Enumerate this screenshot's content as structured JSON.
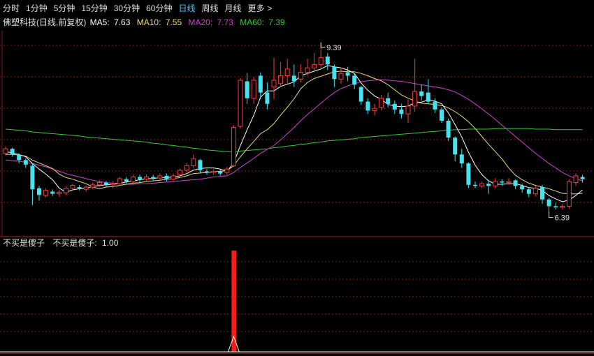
{
  "toolbar": {
    "tabs": [
      {
        "label": "分时",
        "active": false
      },
      {
        "label": "1分钟",
        "active": false
      },
      {
        "label": "5分钟",
        "active": false
      },
      {
        "label": "15分钟",
        "active": false
      },
      {
        "label": "30分钟",
        "active": false
      },
      {
        "label": "60分钟",
        "active": false
      },
      {
        "label": "日线",
        "active": true
      },
      {
        "label": "周线",
        "active": false
      },
      {
        "label": "月线",
        "active": false
      }
    ],
    "more_label": "更多",
    "more_icon": "chevron-right-icon"
  },
  "colors": {
    "background": "#000000",
    "up": "#ff3b3b",
    "down": "#45e3f0",
    "ma5": "#ffffff",
    "ma10": "#e8e070",
    "ma20": "#d040d0",
    "ma60": "#33cc33",
    "grid": "#8a1a1a",
    "signal": "#ff1a1a"
  },
  "chart_data": [
    {
      "type": "candlestick",
      "title": "佛塑科技(日线,前复权)",
      "indicators": [
        {
          "name": "MA5",
          "label": "MA5:",
          "value": "7.63",
          "color": "#ffffff"
        },
        {
          "name": "MA10",
          "label": "MA10:",
          "value": "7.55",
          "color": "#e8e070"
        },
        {
          "name": "MA20",
          "label": "MA20:",
          "value": "7.73",
          "color": "#d040d0"
        },
        {
          "name": "MA60",
          "label": "MA60:",
          "value": "7.39",
          "color": "#33cc33"
        }
      ],
      "annotations": {
        "high": "9.39",
        "low": "6.39"
      },
      "ylim": [
        6.15,
        9.6
      ],
      "grid": true,
      "candles": [
        [
          7.42,
          7.5,
          7.54,
          7.38
        ],
        [
          7.5,
          7.4,
          7.52,
          7.36
        ],
        [
          7.4,
          7.3,
          7.42,
          7.24
        ],
        [
          7.3,
          7.22,
          7.33,
          7.16
        ],
        [
          7.2,
          6.78,
          7.25,
          6.5
        ],
        [
          6.8,
          6.68,
          6.84,
          6.58
        ],
        [
          6.67,
          6.76,
          6.8,
          6.64
        ],
        [
          6.74,
          6.7,
          6.78,
          6.66
        ],
        [
          6.7,
          6.73,
          6.77,
          6.65
        ],
        [
          6.72,
          6.8,
          6.84,
          6.68
        ],
        [
          6.8,
          6.85,
          6.88,
          6.76
        ],
        [
          6.82,
          6.8,
          6.86,
          6.76
        ],
        [
          6.78,
          6.82,
          6.85,
          6.74
        ],
        [
          6.82,
          6.86,
          6.9,
          6.78
        ],
        [
          6.86,
          6.9,
          6.94,
          6.82
        ],
        [
          6.9,
          6.86,
          6.93,
          6.82
        ],
        [
          6.86,
          6.88,
          6.92,
          6.8
        ],
        [
          6.88,
          6.97,
          7.0,
          6.84
        ],
        [
          6.96,
          6.92,
          7.0,
          6.88
        ],
        [
          6.92,
          7.0,
          7.04,
          6.88
        ],
        [
          7.0,
          6.96,
          7.04,
          6.9
        ],
        [
          6.96,
          7.0,
          7.05,
          6.92
        ],
        [
          7.0,
          6.98,
          7.04,
          6.94
        ],
        [
          6.98,
          7.02,
          7.06,
          6.94
        ],
        [
          7.02,
          6.96,
          7.06,
          6.92
        ],
        [
          6.96,
          7.02,
          7.06,
          6.92
        ],
        [
          7.04,
          7.12,
          7.15,
          7.0
        ],
        [
          7.12,
          7.2,
          7.25,
          7.08
        ],
        [
          7.2,
          7.32,
          7.4,
          7.16
        ],
        [
          7.3,
          7.12,
          7.32,
          7.06
        ],
        [
          7.1,
          7.08,
          7.14,
          7.04
        ],
        [
          7.08,
          7.1,
          7.14,
          7.04
        ],
        [
          7.1,
          7.06,
          7.14,
          7.02
        ],
        [
          7.08,
          7.14,
          7.18,
          7.04
        ],
        [
          7.2,
          7.88,
          7.92,
          7.18
        ],
        [
          7.9,
          8.72,
          8.76,
          7.86
        ],
        [
          8.7,
          8.4,
          8.85,
          8.3
        ],
        [
          8.4,
          8.72,
          8.78,
          8.3
        ],
        [
          8.8,
          8.5,
          8.86,
          8.38
        ],
        [
          8.5,
          8.3,
          8.68,
          8.2
        ],
        [
          8.6,
          8.72,
          9.12,
          8.38
        ],
        [
          8.66,
          8.8,
          9.04,
          8.6
        ],
        [
          8.8,
          8.92,
          9.1,
          8.64
        ],
        [
          8.8,
          8.7,
          9.0,
          8.6
        ],
        [
          8.74,
          8.86,
          9.0,
          8.68
        ],
        [
          8.86,
          8.94,
          9.1,
          8.8
        ],
        [
          8.94,
          9.0,
          9.2,
          8.86
        ],
        [
          9.0,
          9.12,
          9.39,
          8.94
        ],
        [
          9.14,
          9.0,
          9.2,
          8.9
        ],
        [
          8.96,
          8.74,
          9.0,
          8.6
        ],
        [
          8.74,
          8.84,
          8.94,
          8.66
        ],
        [
          8.86,
          8.8,
          8.96,
          8.7
        ],
        [
          8.8,
          8.64,
          8.84,
          8.56
        ],
        [
          8.6,
          8.34,
          8.62,
          8.28
        ],
        [
          8.34,
          8.18,
          8.4,
          8.12
        ],
        [
          8.18,
          8.22,
          8.3,
          8.1
        ],
        [
          8.24,
          8.4,
          8.46,
          8.18
        ],
        [
          8.4,
          8.3,
          8.5,
          8.24
        ],
        [
          8.3,
          8.2,
          8.36,
          8.12
        ],
        [
          8.2,
          8.12,
          8.3,
          8.04
        ],
        [
          8.12,
          8.26,
          8.38,
          7.96
        ],
        [
          8.26,
          8.52,
          9.1,
          8.16
        ],
        [
          8.52,
          8.44,
          8.64,
          8.36
        ],
        [
          8.5,
          8.34,
          8.74,
          8.3
        ],
        [
          8.34,
          8.2,
          8.4,
          8.14
        ],
        [
          8.2,
          8.0,
          8.24,
          7.96
        ],
        [
          8.0,
          7.7,
          8.04,
          7.64
        ],
        [
          7.7,
          7.4,
          7.72,
          7.28
        ],
        [
          7.4,
          7.24,
          7.5,
          7.16
        ],
        [
          7.24,
          6.86,
          7.26,
          6.8
        ],
        [
          6.86,
          6.84,
          6.92,
          6.8
        ],
        [
          6.84,
          6.88,
          6.92,
          6.8
        ],
        [
          6.88,
          6.84,
          6.94,
          6.7
        ],
        [
          6.84,
          6.92,
          6.98,
          6.8
        ],
        [
          6.92,
          6.9,
          6.96,
          6.84
        ],
        [
          6.9,
          6.92,
          6.98,
          6.86
        ],
        [
          6.94,
          6.84,
          6.96,
          6.78
        ],
        [
          6.84,
          6.78,
          6.88,
          6.72
        ],
        [
          6.78,
          6.7,
          6.82,
          6.64
        ],
        [
          6.7,
          6.8,
          6.84,
          6.66
        ],
        [
          6.82,
          6.6,
          6.86,
          6.52
        ],
        [
          6.6,
          6.48,
          6.62,
          6.39
        ],
        [
          6.48,
          6.46,
          6.54,
          6.42
        ],
        [
          6.46,
          6.48,
          6.52,
          6.42
        ],
        [
          6.48,
          6.92,
          6.96,
          6.44
        ],
        [
          6.9,
          7.02,
          7.06,
          6.84
        ],
        [
          7.0,
          6.96,
          7.04,
          6.9
        ]
      ],
      "ma5": [
        7.45,
        7.43,
        7.4,
        7.36,
        7.24,
        7.14,
        7.05,
        6.95,
        6.8,
        6.73,
        6.77,
        6.79,
        6.8,
        6.83,
        6.85,
        6.86,
        6.87,
        6.89,
        6.91,
        6.93,
        6.95,
        6.97,
        6.97,
        6.99,
        6.99,
        7.0,
        7.02,
        7.06,
        7.12,
        7.15,
        7.16,
        7.16,
        7.14,
        7.1,
        7.25,
        7.56,
        7.84,
        8.1,
        8.42,
        8.53,
        8.53,
        8.61,
        8.65,
        8.69,
        8.8,
        8.84,
        8.88,
        8.92,
        8.98,
        8.96,
        8.94,
        8.9,
        8.84,
        8.67,
        8.54,
        8.44,
        8.38,
        8.29,
        8.26,
        8.25,
        8.26,
        8.32,
        8.33,
        8.37,
        8.35,
        8.3,
        8.14,
        7.93,
        7.71,
        7.44,
        7.21,
        7.04,
        6.93,
        6.87,
        6.87,
        6.88,
        6.88,
        6.85,
        6.81,
        6.8,
        6.76,
        6.67,
        6.61,
        6.56,
        6.59,
        6.67,
        6.77
      ],
      "ma10": [
        7.4,
        7.4,
        7.39,
        7.37,
        7.3,
        7.25,
        7.2,
        7.15,
        7.05,
        6.99,
        6.96,
        6.92,
        6.88,
        6.82,
        6.79,
        6.82,
        6.83,
        6.85,
        6.87,
        6.89,
        6.9,
        6.92,
        6.93,
        6.94,
        6.96,
        6.97,
        6.99,
        7.02,
        7.06,
        7.07,
        7.08,
        7.09,
        7.1,
        7.11,
        7.2,
        7.36,
        7.5,
        7.63,
        7.77,
        7.84,
        7.95,
        8.1,
        8.24,
        8.39,
        8.57,
        8.68,
        8.75,
        8.79,
        8.83,
        8.87,
        8.88,
        8.87,
        8.87,
        8.84,
        8.8,
        8.75,
        8.71,
        8.64,
        8.55,
        8.46,
        8.4,
        8.35,
        8.31,
        8.3,
        8.29,
        8.27,
        8.23,
        8.16,
        8.08,
        7.98,
        7.86,
        7.72,
        7.58,
        7.45,
        7.32,
        7.16,
        7.03,
        6.95,
        6.89,
        6.85,
        6.82,
        6.79,
        6.75,
        6.71,
        6.7,
        6.7,
        6.71
      ],
      "ma20": [
        7.3,
        7.29,
        7.28,
        7.26,
        7.24,
        7.21,
        7.18,
        7.14,
        7.1,
        7.06,
        7.03,
        7.0,
        6.97,
        6.94,
        6.92,
        6.9,
        6.89,
        6.88,
        6.87,
        6.87,
        6.88,
        6.88,
        6.89,
        6.9,
        6.91,
        6.92,
        6.93,
        6.94,
        6.95,
        6.96,
        6.98,
        7.0,
        7.01,
        7.02,
        7.08,
        7.17,
        7.25,
        7.33,
        7.42,
        7.49,
        7.56,
        7.66,
        7.77,
        7.88,
        8.0,
        8.11,
        8.21,
        8.31,
        8.41,
        8.5,
        8.57,
        8.62,
        8.66,
        8.69,
        8.71,
        8.72,
        8.73,
        8.72,
        8.71,
        8.7,
        8.68,
        8.66,
        8.64,
        8.62,
        8.6,
        8.58,
        8.55,
        8.51,
        8.45,
        8.38,
        8.3,
        8.21,
        8.12,
        8.02,
        7.92,
        7.82,
        7.72,
        7.62,
        7.52,
        7.42,
        7.33,
        7.24,
        7.16,
        7.08,
        7.02,
        6.97,
        6.93
      ],
      "ma60": [
        7.85,
        7.84,
        7.83,
        7.82,
        7.8,
        7.79,
        7.78,
        7.77,
        7.76,
        7.75,
        7.74,
        7.73,
        7.71,
        7.7,
        7.69,
        7.68,
        7.67,
        7.66,
        7.65,
        7.64,
        7.63,
        7.62,
        7.6,
        7.59,
        7.57,
        7.56,
        7.54,
        7.53,
        7.51,
        7.5,
        7.48,
        7.47,
        7.46,
        7.45,
        7.45,
        7.46,
        7.47,
        7.48,
        7.49,
        7.5,
        7.52,
        7.53,
        7.55,
        7.56,
        7.58,
        7.59,
        7.61,
        7.62,
        7.64,
        7.65,
        7.66,
        7.67,
        7.68,
        7.7,
        7.71,
        7.72,
        7.73,
        7.74,
        7.75,
        7.76,
        7.77,
        7.78,
        7.79,
        7.8,
        7.81,
        7.82,
        7.83,
        7.84,
        7.84,
        7.85,
        7.85,
        7.85,
        7.85,
        7.86,
        7.86,
        7.86,
        7.86,
        7.86,
        7.86,
        7.85,
        7.85,
        7.85,
        7.84,
        7.84,
        7.84,
        7.84,
        7.84
      ]
    },
    {
      "type": "bar",
      "title": "不买是傻子",
      "series_label": "不买是傻子:",
      "value_label": "1.00",
      "ylim": [
        0,
        1.0
      ],
      "grid": true,
      "signal_index": 34,
      "signal_value": 1.0
    }
  ]
}
